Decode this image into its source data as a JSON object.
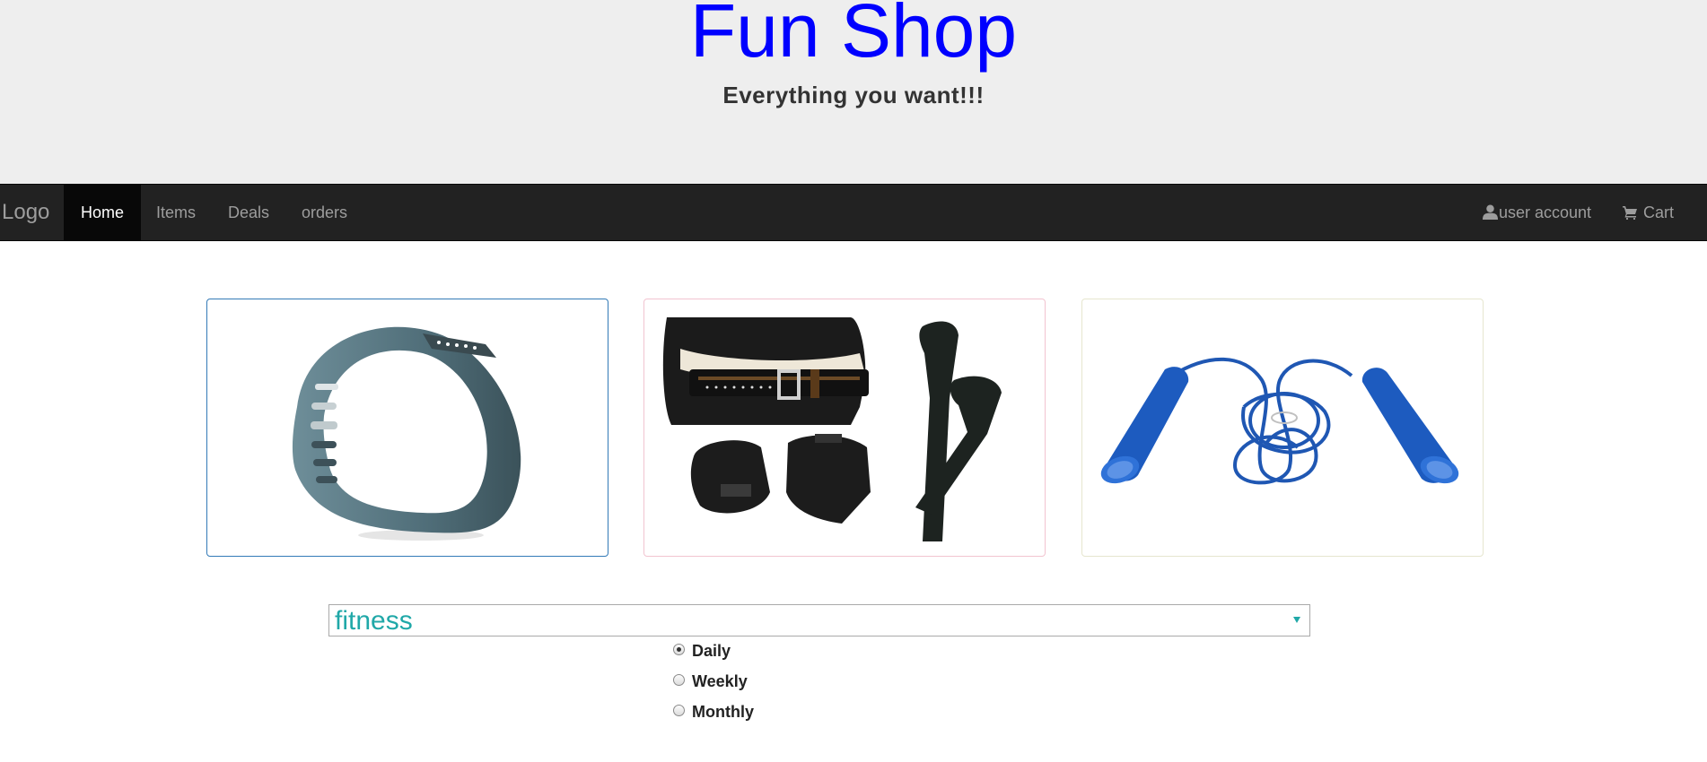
{
  "header": {
    "title": "Fun Shop",
    "tagline": "Everything you want!!!",
    "title_color": "#0000ff"
  },
  "navbar": {
    "brand": "Logo",
    "items": [
      {
        "label": "Home",
        "active": true
      },
      {
        "label": "Items",
        "active": false
      },
      {
        "label": "Deals",
        "active": false
      },
      {
        "label": "orders",
        "active": false
      }
    ],
    "right": [
      {
        "label": "user account",
        "icon": "user-icon"
      },
      {
        "label": "Cart",
        "icon": "cart-icon"
      }
    ]
  },
  "products": [
    {
      "name": "fitness tracker band",
      "icon": "fitness-band-image"
    },
    {
      "name": "weightlifting belt, gloves and straps",
      "icon": "lifting-gear-image"
    },
    {
      "name": "jump rope",
      "icon": "jump-rope-image"
    }
  ],
  "category_select": {
    "value": "fitness",
    "accent_color": "#20a8a8"
  },
  "frequency": {
    "options": [
      {
        "label": "Daily",
        "checked": true
      },
      {
        "label": "Weekly",
        "checked": false
      },
      {
        "label": "Monthly",
        "checked": false
      }
    ]
  }
}
